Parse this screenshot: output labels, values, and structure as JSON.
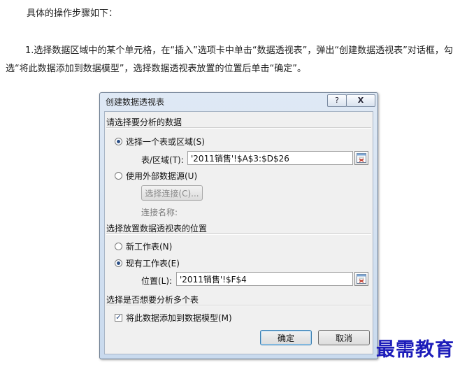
{
  "article": {
    "intro": "具体的操作步骤如下：",
    "step1": "1.选择数据区域中的某个单元格，在“插入”选项卡中单击“数据透视表”，弹出“创建数据透视表”对话框，勾选“将此数据添加到数据模型”，选择数据透视表放置的位置后单击“确定”。"
  },
  "dialog": {
    "title": "创建数据透视表",
    "help_label": "?",
    "close_label": "X",
    "section1": "请选择要分析的数据",
    "opt_table": "选择一个表或区域(S)",
    "range_label": "表/区域(T):",
    "range_value": "'2011销售'!$A$3:$D$26",
    "opt_external": "使用外部数据源(U)",
    "choose_conn": "选择连接(C)...",
    "conn_name": "连接名称:",
    "section2": "选择放置数据透视表的位置",
    "opt_new_sheet": "新工作表(N)",
    "opt_existing_sheet": "现有工作表(E)",
    "location_label": "位置(L):",
    "location_value": "'2011销售'!$F$4",
    "section3": "选择是否想要分析多个表",
    "add_model": "将此数据添加到数据模型(M)",
    "add_model_checked": true,
    "ok": "确定",
    "cancel": "取消"
  },
  "watermark": "最需教育"
}
